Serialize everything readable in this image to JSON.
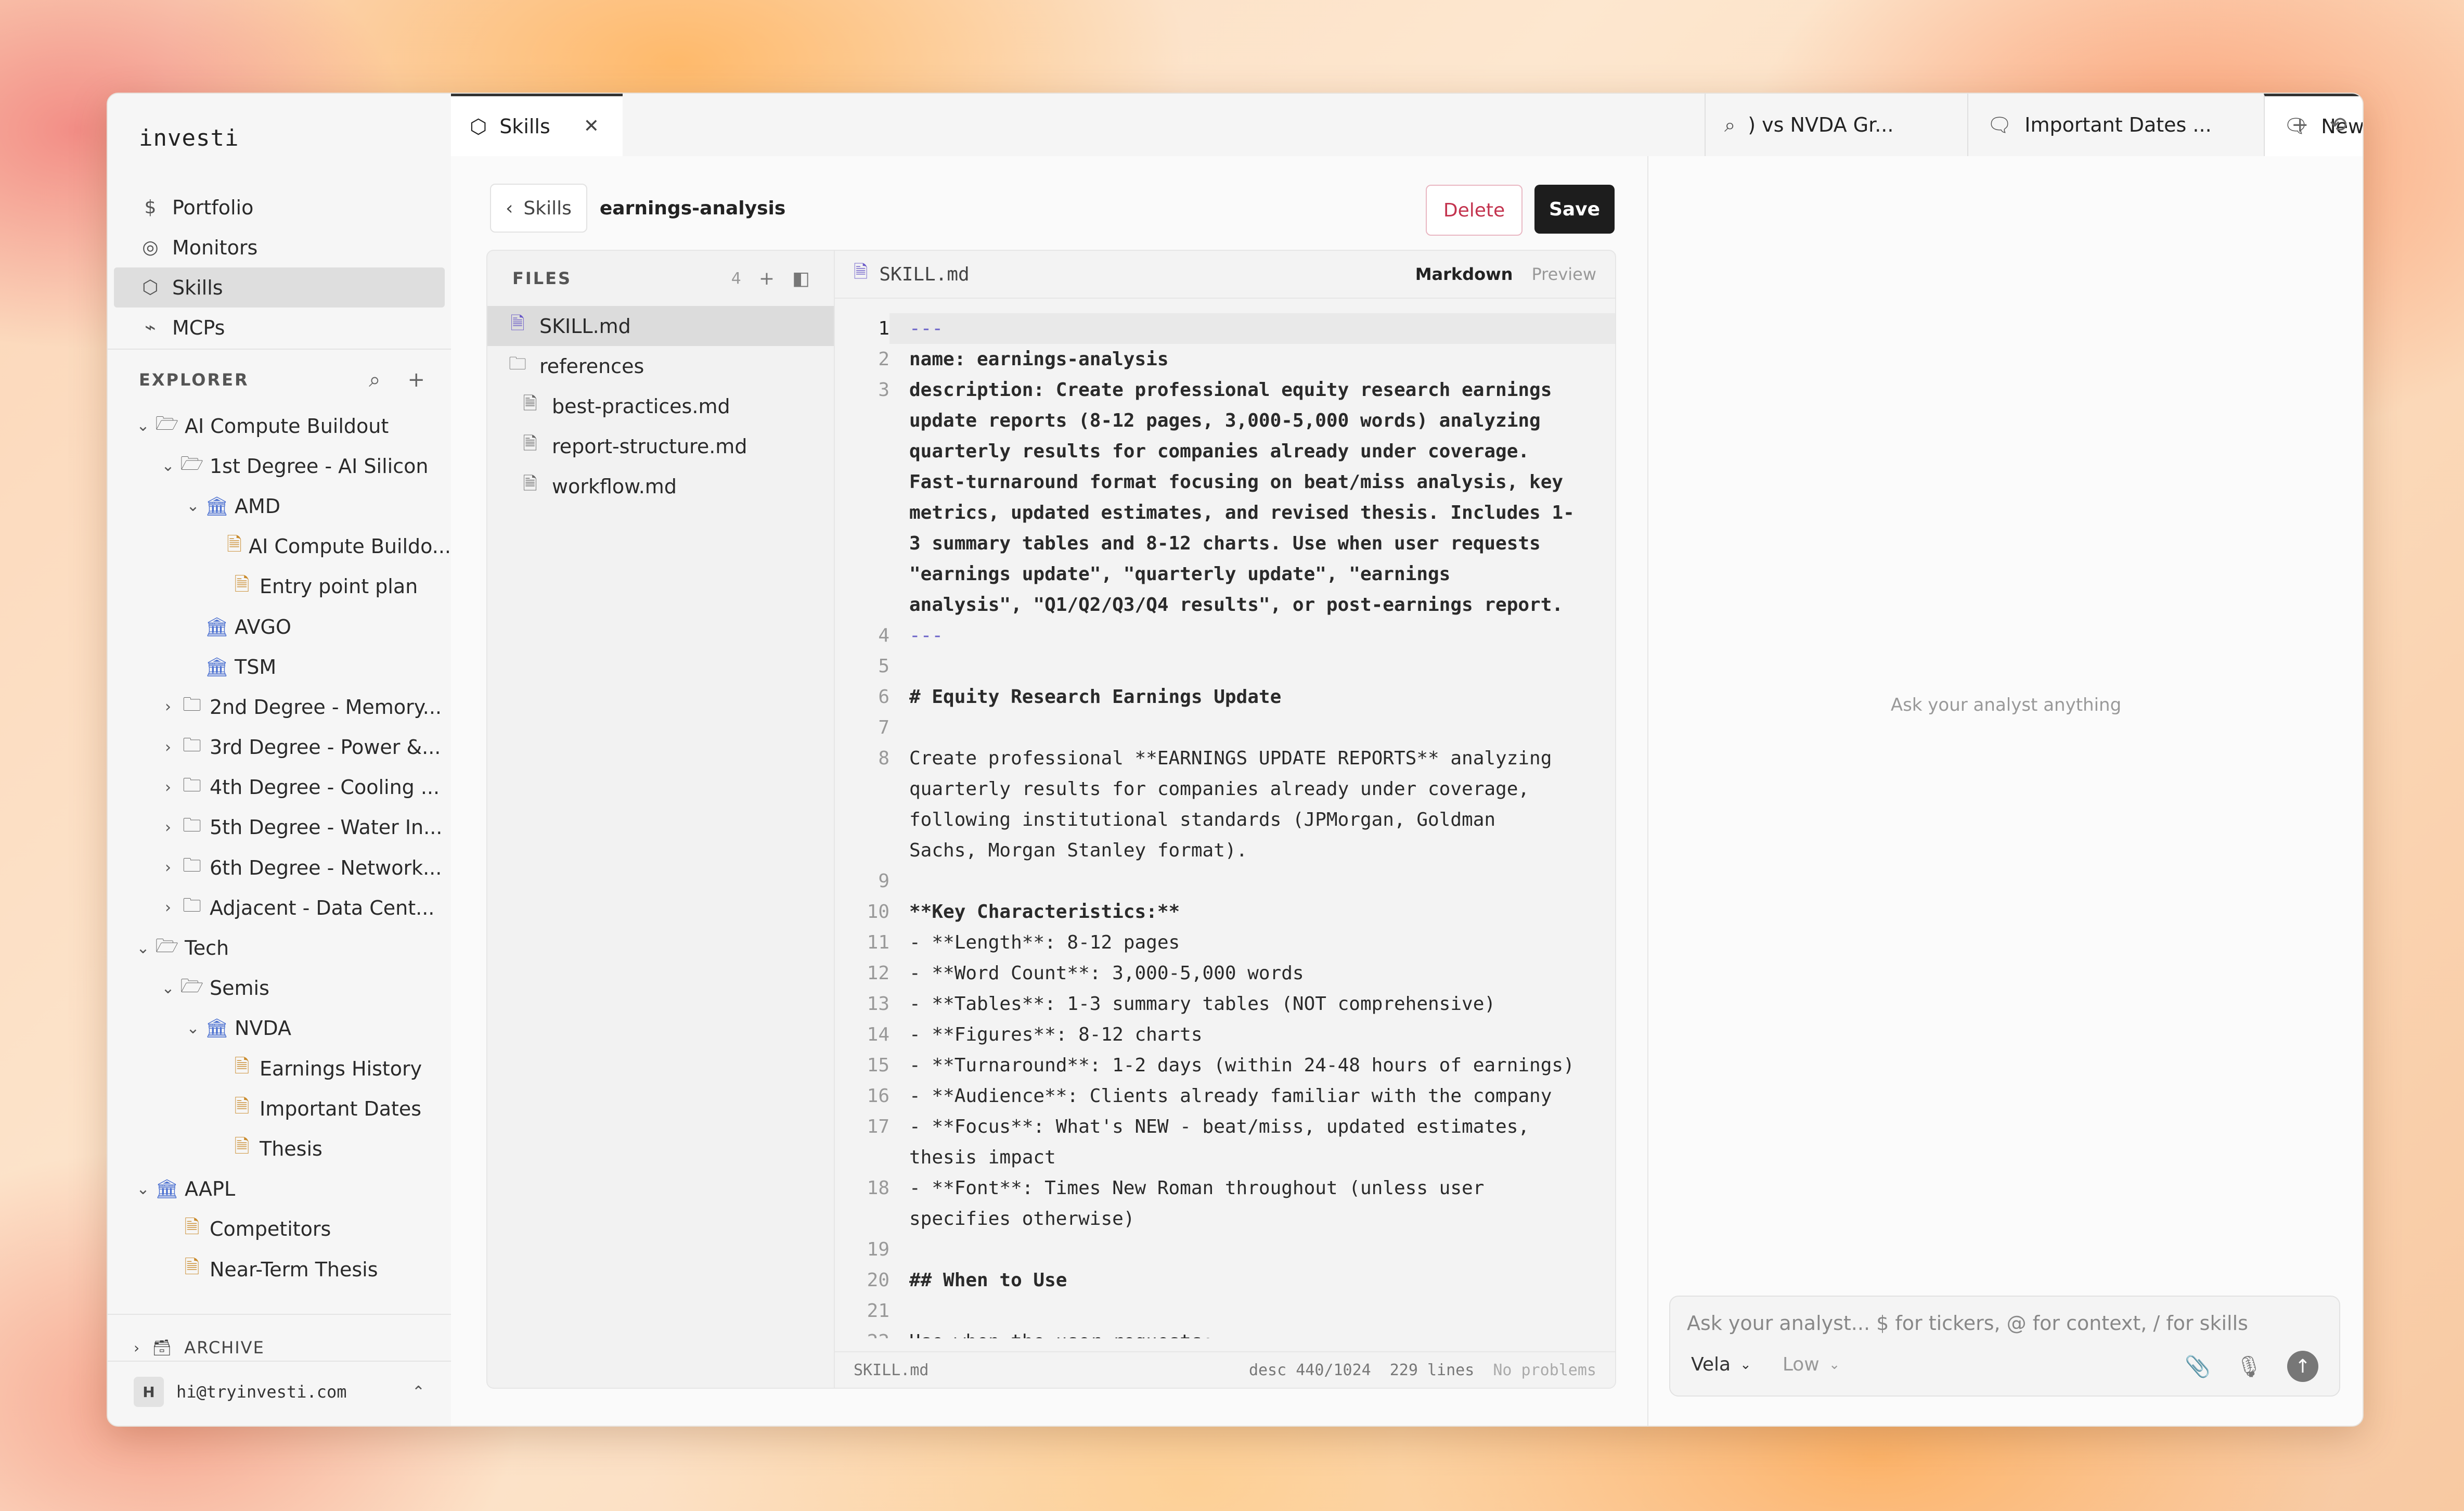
{
  "app": {
    "brand": "investi"
  },
  "nav": [
    {
      "label": "Portfolio",
      "icon": "dollar-icon"
    },
    {
      "label": "Monitors",
      "icon": "radar-icon"
    },
    {
      "label": "Skills",
      "icon": "hexagon-icon",
      "active": true
    },
    {
      "label": "MCPs",
      "icon": "plug-icon"
    }
  ],
  "explorer": {
    "title": "EXPLORER",
    "tree": [
      {
        "label": "AI Compute Buildout",
        "type": "folder-open",
        "depth": 0,
        "chev": "down"
      },
      {
        "label": "1st Degree - AI Silicon",
        "type": "folder-open",
        "depth": 1,
        "chev": "down"
      },
      {
        "label": "AMD",
        "type": "ticker",
        "depth": 2,
        "chev": "down"
      },
      {
        "label": "AI Compute Buildo...",
        "type": "note",
        "depth": 3,
        "chev": ""
      },
      {
        "label": "Entry point plan",
        "type": "note",
        "depth": 3,
        "chev": ""
      },
      {
        "label": "AVGO",
        "type": "ticker",
        "depth": 2,
        "chev": ""
      },
      {
        "label": "TSM",
        "type": "ticker",
        "depth": 2,
        "chev": ""
      },
      {
        "label": "2nd Degree - Memory...",
        "type": "folder",
        "depth": 1,
        "chev": "right"
      },
      {
        "label": "3rd Degree - Power &...",
        "type": "folder",
        "depth": 1,
        "chev": "right"
      },
      {
        "label": "4th Degree - Cooling ...",
        "type": "folder",
        "depth": 1,
        "chev": "right"
      },
      {
        "label": "5th Degree - Water In...",
        "type": "folder",
        "depth": 1,
        "chev": "right"
      },
      {
        "label": "6th Degree - Network...",
        "type": "folder",
        "depth": 1,
        "chev": "right"
      },
      {
        "label": "Adjacent - Data Cent...",
        "type": "folder",
        "depth": 1,
        "chev": "right"
      },
      {
        "label": "Tech",
        "type": "folder-open",
        "depth": 0,
        "chev": "down"
      },
      {
        "label": "Semis",
        "type": "folder-open",
        "depth": 1,
        "chev": "down"
      },
      {
        "label": "NVDA",
        "type": "ticker",
        "depth": 2,
        "chev": "down"
      },
      {
        "label": "Earnings History",
        "type": "note",
        "depth": 3,
        "chev": ""
      },
      {
        "label": "Important Dates",
        "type": "note",
        "depth": 3,
        "chev": ""
      },
      {
        "label": "Thesis",
        "type": "note",
        "depth": 3,
        "chev": ""
      },
      {
        "label": "AAPL",
        "type": "ticker",
        "depth": 0,
        "chev": "down"
      },
      {
        "label": "Competitors",
        "type": "note",
        "depth": 1,
        "chev": ""
      },
      {
        "label": "Near-Term Thesis",
        "type": "note",
        "depth": 1,
        "chev": ""
      }
    ],
    "archive_label": "ARCHIVE"
  },
  "user": {
    "initial": "H",
    "email": "hi@tryinvesti.com"
  },
  "tabs": {
    "skills": "Skills",
    "search": ") vs NVDA Gr...",
    "dates": "Important Dates ...",
    "new": "New Ar"
  },
  "editor": {
    "back_label": "Skills",
    "current": "earnings-analysis",
    "delete_label": "Delete",
    "save_label": "Save",
    "files_title": "FILES",
    "files_count": "4",
    "files": [
      {
        "label": "SKILL.md",
        "type": "doc",
        "depth": 0,
        "active": true
      },
      {
        "label": "references",
        "type": "folder",
        "depth": 0
      },
      {
        "label": "best-practices.md",
        "type": "doc",
        "depth": 1
      },
      {
        "label": "report-structure.md",
        "type": "doc",
        "depth": 1
      },
      {
        "label": "workflow.md",
        "type": "doc",
        "depth": 1
      }
    ],
    "open_file": "SKILL.md",
    "mode_markdown": "Markdown",
    "mode_preview": "Preview",
    "lines": [
      {
        "n": "1",
        "text": "---",
        "cls": "dash cur"
      },
      {
        "n": "2",
        "text": "name: earnings-analysis",
        "cls": "b"
      },
      {
        "n": "3",
        "text": "description: Create professional equity research earnings",
        "cls": "b"
      },
      {
        "n": "",
        "text": "update reports (8-12 pages, 3,000-5,000 words) analyzing",
        "cls": "b"
      },
      {
        "n": "",
        "text": "quarterly results for companies already under coverage.",
        "cls": "b"
      },
      {
        "n": "",
        "text": "Fast-turnaround format focusing on beat/miss analysis, key",
        "cls": "b"
      },
      {
        "n": "",
        "text": "metrics, updated estimates, and revised thesis. Includes 1-",
        "cls": "b"
      },
      {
        "n": "",
        "text": "3 summary tables and 8-12 charts. Use when user requests",
        "cls": "b"
      },
      {
        "n": "",
        "text": "\"earnings update\", \"quarterly update\", \"earnings",
        "cls": "b"
      },
      {
        "n": "",
        "text": "analysis\", \"Q1/Q2/Q3/Q4 results\", or post-earnings report.",
        "cls": "b"
      },
      {
        "n": "4",
        "text": "---",
        "cls": "dash"
      },
      {
        "n": "5",
        "text": "",
        "cls": ""
      },
      {
        "n": "6",
        "text": "# Equity Research Earnings Update",
        "cls": "b"
      },
      {
        "n": "7",
        "text": "",
        "cls": ""
      },
      {
        "n": "8",
        "text": "Create professional **EARNINGS UPDATE REPORTS** analyzing",
        "cls": ""
      },
      {
        "n": "",
        "text": "quarterly results for companies already under coverage,",
        "cls": ""
      },
      {
        "n": "",
        "text": "following institutional standards (JPMorgan, Goldman",
        "cls": ""
      },
      {
        "n": "",
        "text": "Sachs, Morgan Stanley format).",
        "cls": ""
      },
      {
        "n": "9",
        "text": "",
        "cls": ""
      },
      {
        "n": "10",
        "text": "**Key Characteristics:**",
        "cls": "b"
      },
      {
        "n": "11",
        "text": "- **Length**: 8-12 pages",
        "cls": ""
      },
      {
        "n": "12",
        "text": "- **Word Count**: 3,000-5,000 words",
        "cls": ""
      },
      {
        "n": "13",
        "text": "- **Tables**: 1-3 summary tables (NOT comprehensive)",
        "cls": ""
      },
      {
        "n": "14",
        "text": "- **Figures**: 8-12 charts",
        "cls": ""
      },
      {
        "n": "15",
        "text": "- **Turnaround**: 1-2 days (within 24-48 hours of earnings)",
        "cls": ""
      },
      {
        "n": "16",
        "text": "- **Audience**: Clients already familiar with the company",
        "cls": ""
      },
      {
        "n": "17",
        "text": "- **Focus**: What's NEW - beat/miss, updated estimates,",
        "cls": ""
      },
      {
        "n": "",
        "text": "thesis impact",
        "cls": ""
      },
      {
        "n": "18",
        "text": "- **Font**: Times New Roman throughout (unless user",
        "cls": ""
      },
      {
        "n": "",
        "text": "specifies otherwise)",
        "cls": ""
      },
      {
        "n": "19",
        "text": "",
        "cls": ""
      },
      {
        "n": "20",
        "text": "## When to Use",
        "cls": "b"
      },
      {
        "n": "21",
        "text": "",
        "cls": ""
      },
      {
        "n": "22",
        "text": "Use when the user requests:",
        "cls": ""
      }
    ],
    "footer_file": "SKILL.md",
    "footer_desc": "desc 440/1024",
    "footer_lines": "229 lines",
    "footer_problems": "No problems"
  },
  "chat": {
    "empty_hint": "Ask your analyst anything",
    "placeholder": "Ask your analyst... $ for tickers, @ for context, / for skills",
    "model": "Vela",
    "effort": "Low"
  }
}
